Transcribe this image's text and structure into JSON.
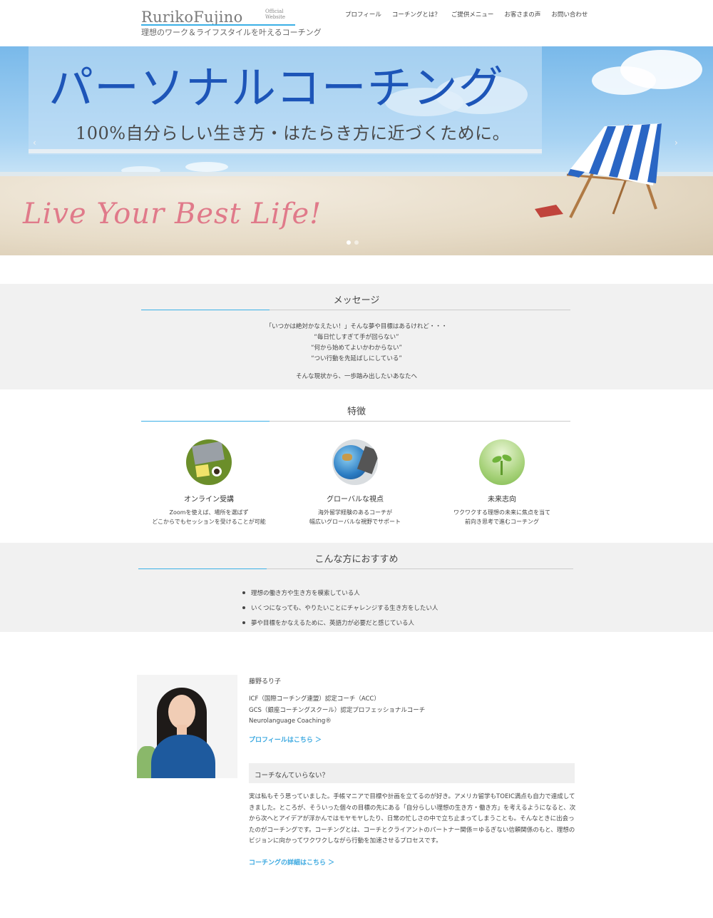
{
  "header": {
    "logo_name": "RurikoFujino",
    "logo_official": "Official Website",
    "logo_tagline": "理想のワーク＆ライフスタイルを叶えるコーチング",
    "nav": [
      "プロフィール",
      "コーチングとは？",
      "ご提供メニュー",
      "お客さまの声",
      "お問い合わせ"
    ]
  },
  "hero": {
    "title": "パーソナルコーチング",
    "subtitle": "100%自分らしい生き方・はたらき方に近づくために。",
    "script": "Live Your Best Life!",
    "prev_arrow": "‹",
    "next_arrow": "›"
  },
  "message": {
    "title": "メッセージ",
    "lines": [
      "「いつかは絶対かなえたい！」そんな夢や目標はあるけれど・・・",
      "“毎日忙しすぎて手が回らない”",
      "“何から始めてよいかわからない”",
      "“つい行動を先延ばしにしている”"
    ],
    "closing": "そんな現状から、一歩踏み出したいあなたへ"
  },
  "features": {
    "title": "特徴",
    "items": [
      {
        "title": "オンライン受講",
        "desc1": "Zoomを使えば、場所を選ばず",
        "desc2": "どこからでもセッションを受けることが可能",
        "icon": "laptop-desk-icon"
      },
      {
        "title": "グローバルな視点",
        "desc1": "海外留学経験のあるコーチが",
        "desc2": "幅広いグローバルな視野でサポート",
        "icon": "globe-icon"
      },
      {
        "title": "未来志向",
        "desc1": "ワクワクする理想の未来に焦点を当て",
        "desc2": "前向き思考で進むコーチング",
        "icon": "sprout-icon"
      }
    ]
  },
  "recommend": {
    "title": "こんな方におすすめ",
    "items": [
      "理想の働き方や生き方を模索している人",
      "いくつになっても、やりたいことにチャレンジする生き方をしたい人",
      "夢や目標をかなえるために、英語力が必要だと感じている人"
    ]
  },
  "profile": {
    "name": "藤野るり子",
    "credentials": [
      "ICF（国際コーチング連盟）認定コーチ（ACC）",
      "GCS（銀座コーチングスクール）認定プロフェッショナルコーチ",
      "Neurolanguage Coaching®"
    ],
    "profile_link": "プロフィールはこちら ＞",
    "box_heading": "コーチなんていらない？",
    "body": "実は私もそう思っていました。手帳マニアで目標や計画を立てるのが好き。アメリカ留学もTOEIC満点も自力で達成してきました。ところが、そういった個々の目標の先にある「自分らしい理想の生き方・働き方」を考えるようになると、次から次へとアイデアが浮かんではモヤモヤしたり、日常の忙しさの中で立ち止まってしまうことも。そんなときに出会ったのがコーチングです。コーチングとは、コーチとクライアントのパートナー関係＝ゆるぎない信頼関係のもと、理想のビジョンに向かってワクワクしながら行動を加速させるプロセスです。",
    "coaching_link": "コーチングの詳細はこちら ＞"
  },
  "colors": {
    "accent": "#3bb0e6",
    "hero_title": "#1d55b8",
    "script": "#e07a8a",
    "section_bg": "#f1f1f1"
  }
}
